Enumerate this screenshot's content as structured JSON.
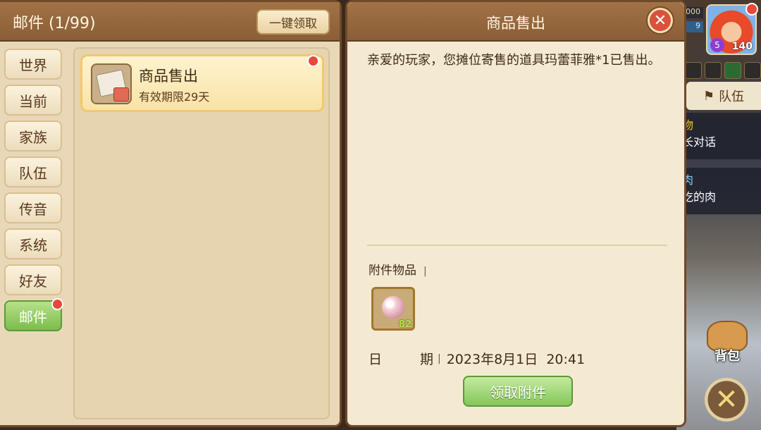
{
  "mail_window": {
    "title": "邮件 (1/99)",
    "one_click_claim_label": "一键领取",
    "categories": [
      "世界",
      "当前",
      "家族",
      "队伍",
      "传音",
      "系统",
      "好友",
      "邮件"
    ],
    "active_category": "邮件",
    "mails": [
      {
        "title": "商品售出",
        "expiry": "有效期限29天",
        "unread": true
      }
    ]
  },
  "detail": {
    "title": "商品售出",
    "body": "亲爱的玩家，您摊位寄售的道具玛蕾菲雅*1已售出。",
    "attachment_label": "附件物品",
    "attachment_separator": "|",
    "attachment": {
      "icon": "pearl-icon",
      "quantity": "82"
    },
    "date_label_1": "日",
    "date_label_2": "期",
    "date_value": "2023年8月1日  20:41",
    "claim_button_label": "领取附件"
  },
  "game_hud": {
    "stat_1": "000",
    "stat_2": "9",
    "avatar_level": "5",
    "avatar_number": "140",
    "team_button_label": "队伍",
    "quest_1_title": "物",
    "quest_1_text": "长对话",
    "quest_2_title": "肉",
    "quest_2_text": "吃的肉",
    "bag_label": "背包"
  }
}
